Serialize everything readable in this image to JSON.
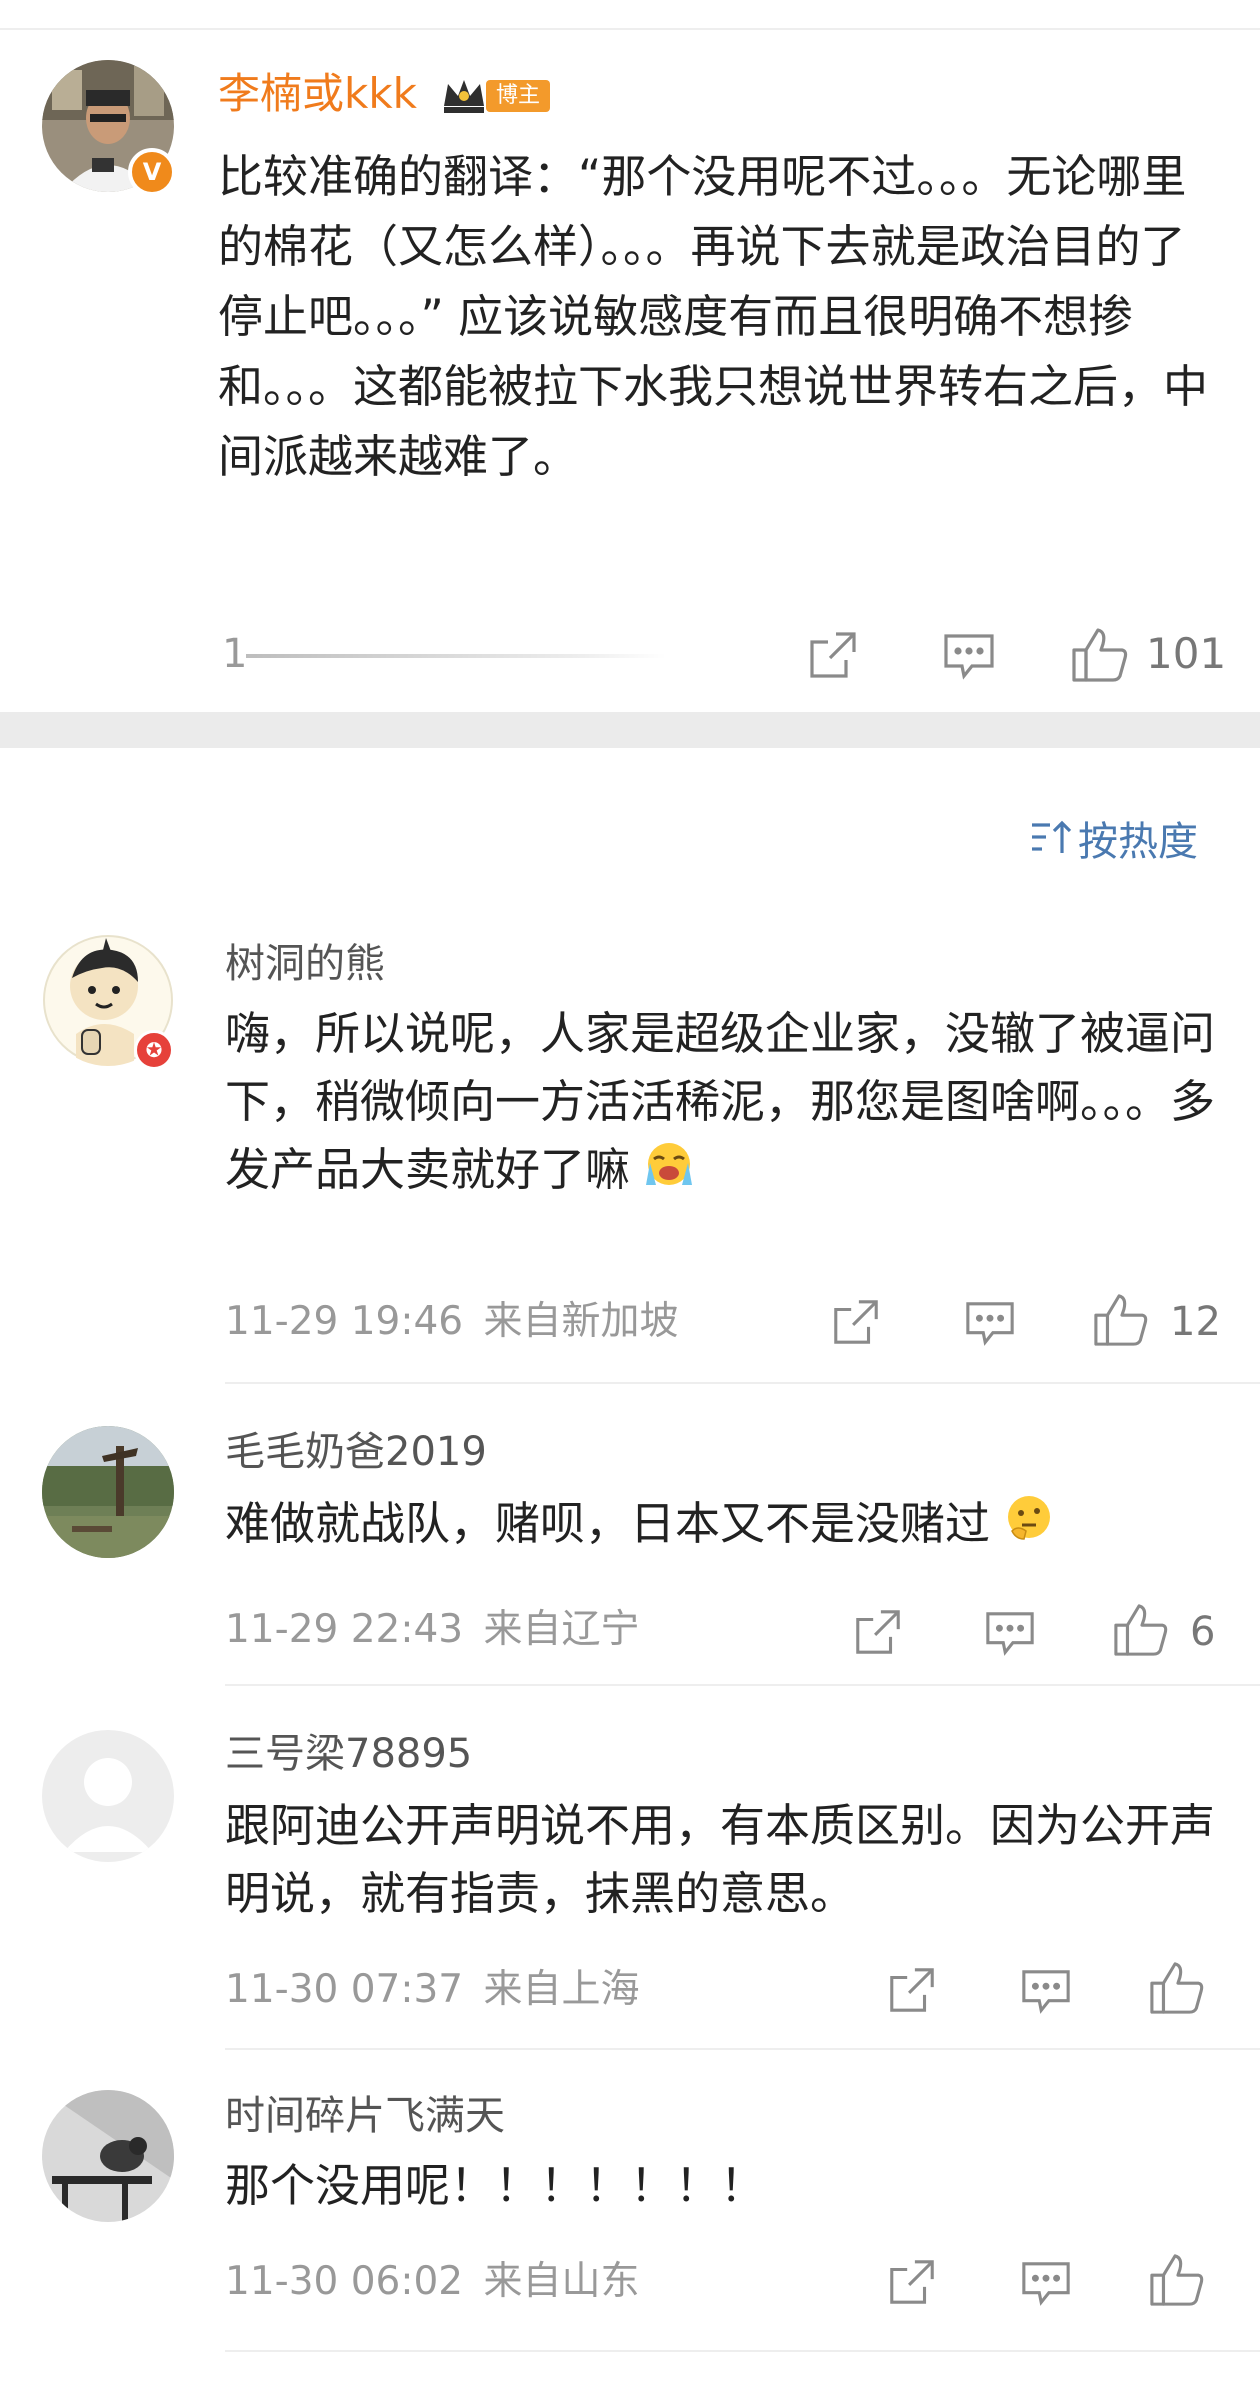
{
  "original_post": {
    "author": "李楠或kkk",
    "badge_label": "博主",
    "verified_mark": "V",
    "text": "比较准确的翻译：“那个没用呢不过。。。无论哪里的棉花（又怎么样）。。。再说下去就是政治目的了停止吧。。。” 应该说敏感度有而且很明确不想掺和。。。这都能被拉下水我只想说世界转右之后，中间派越来越难了。",
    "count": "1",
    "likes": "101"
  },
  "sort": {
    "label": "按热度",
    "icon": "sort-icon"
  },
  "comments": [
    {
      "user": "树洞的熊",
      "text": "嗨，所以说呢，人家是超级企业家，没辙了被逼问下，稍微倾向一方活活稀泥，那您是图啥啊。。。多发产品大卖就好了嘛",
      "emoji": "crying-emoji",
      "time": "11-29 19:46",
      "location": "来自新加坡",
      "likes": "12",
      "vip_mark": "✪"
    },
    {
      "user": "毛毛奶爸2019",
      "text": "难做就战队，赌呗，日本又不是没赌过",
      "emoji": "thinking-emoji",
      "time": "11-29 22:43",
      "location": "来自辽宁",
      "likes": "6"
    },
    {
      "user": "三号梁78895",
      "text": "跟阿迪公开声明说不用，有本质区别。因为公开声明说，就有指责，抹黑的意思。",
      "time": "11-30 07:37",
      "location": "来自上海",
      "likes": ""
    },
    {
      "user": "时间碎片飞满天",
      "text": "那个没用呢！！！！！！！",
      "time": "11-30 06:02",
      "location": "来自山东",
      "likes": ""
    }
  ],
  "icons": {
    "share": "share-icon",
    "comment": "comment-icon",
    "like": "like-icon"
  },
  "colors": {
    "author_orange": "#f07b1c",
    "link_blue": "#4a79b0",
    "meta_gray": "#999999"
  }
}
